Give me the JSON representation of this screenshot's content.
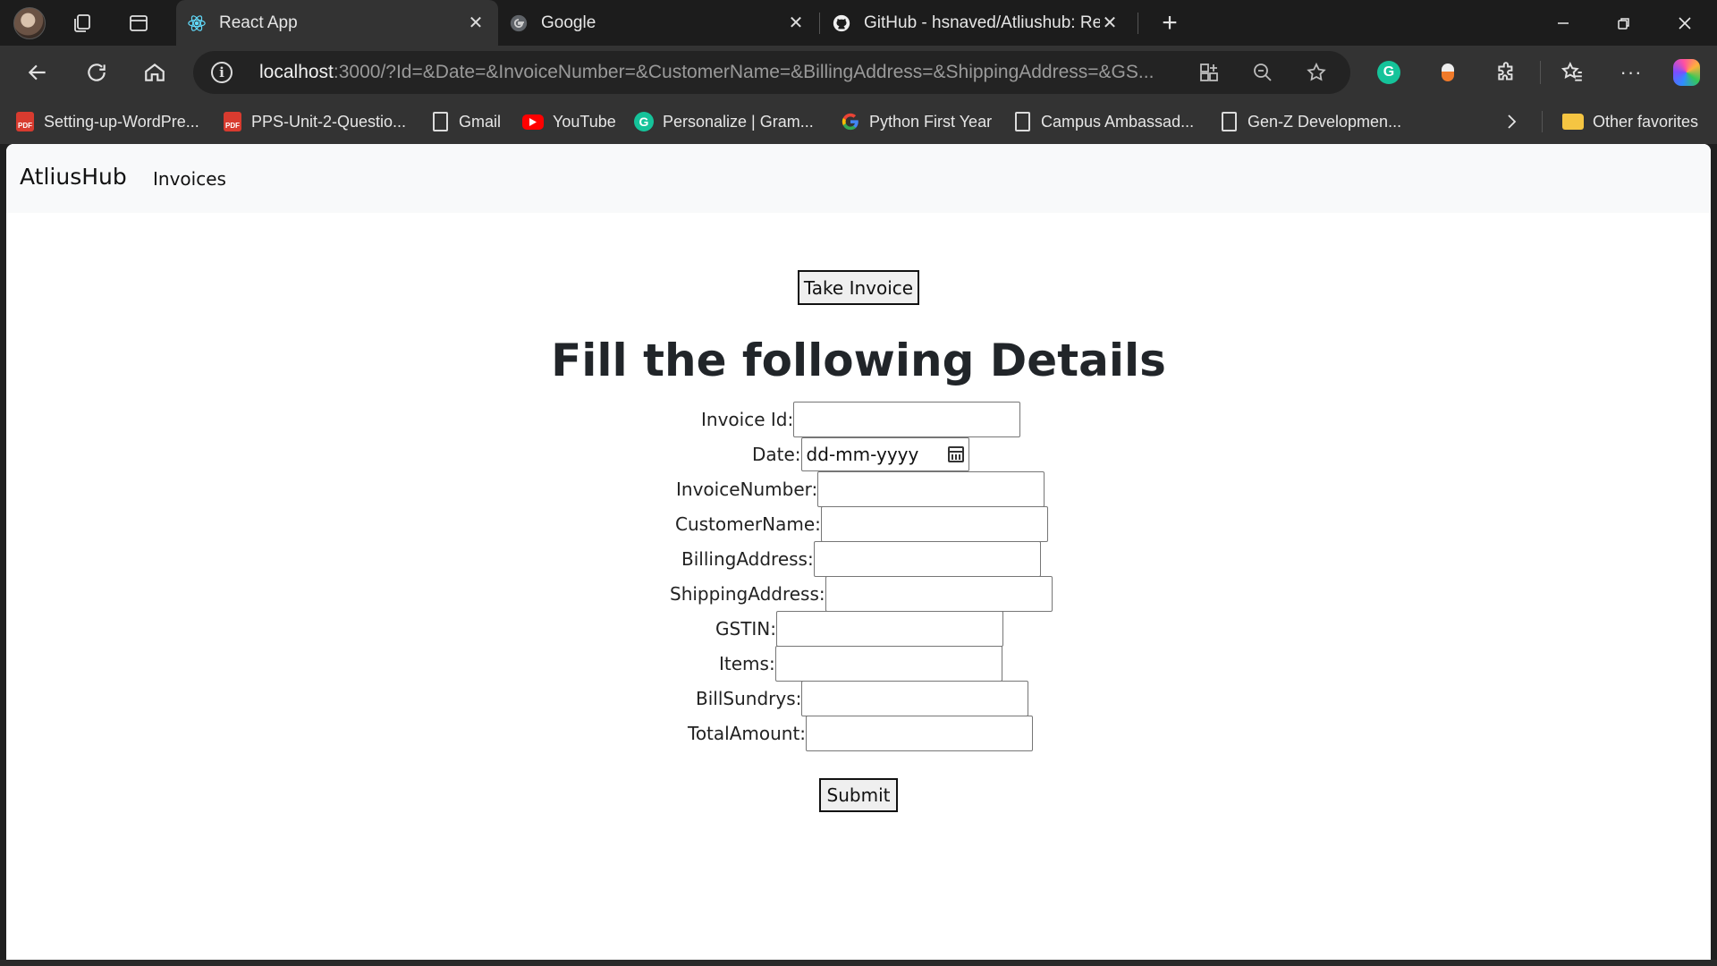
{
  "browser": {
    "tabs": [
      {
        "title": "React App",
        "active": true
      },
      {
        "title": "Google",
        "active": false
      },
      {
        "title": "GitHub - hsnaved/Atliushub: Recr",
        "active": false
      }
    ],
    "address": {
      "host": "localhost",
      "rest": ":3000/?Id=&Date=&InvoiceNumber=&CustomerName=&BillingAddress=&ShippingAddress=&GS..."
    },
    "bookmarks": [
      {
        "label": "Setting-up-WordPre...",
        "icon": "pdf-icon"
      },
      {
        "label": "PPS-Unit-2-Questio...",
        "icon": "pdf-icon"
      },
      {
        "label": "Gmail",
        "icon": "page-icon"
      },
      {
        "label": "YouTube",
        "icon": "youtube-icon"
      },
      {
        "label": "Personalize | Gram...",
        "icon": "grammarly-icon"
      },
      {
        "label": "Python First Year",
        "icon": "google-icon"
      },
      {
        "label": "Campus Ambassad...",
        "icon": "page-icon"
      },
      {
        "label": "Gen-Z Developmen...",
        "icon": "page-icon"
      }
    ],
    "other_favorites": "Other favorites",
    "accent_colors": {
      "grammarly": "#15c39a",
      "youtube": "#ff0000",
      "pdf": "#d83b2f",
      "folder": "#f5c542"
    }
  },
  "app": {
    "brand": "AtliusHub",
    "nav_link": "Invoices",
    "take_invoice": "Take Invoice",
    "heading": "Fill the following Details",
    "fields": [
      {
        "label": "Invoice Id:",
        "value": ""
      },
      {
        "label": "Date:",
        "placeholder": "dd-mm-yyyy"
      },
      {
        "label": "InvoiceNumber:",
        "value": ""
      },
      {
        "label": "CustomerName:",
        "value": ""
      },
      {
        "label": "BillingAddress:",
        "value": ""
      },
      {
        "label": "ShippingAddress:",
        "value": ""
      },
      {
        "label": "GSTIN:",
        "value": ""
      },
      {
        "label": "Items:",
        "value": ""
      },
      {
        "label": "BillSundrys:",
        "value": ""
      },
      {
        "label": "TotalAmount:",
        "value": ""
      }
    ],
    "submit": "Submit"
  }
}
